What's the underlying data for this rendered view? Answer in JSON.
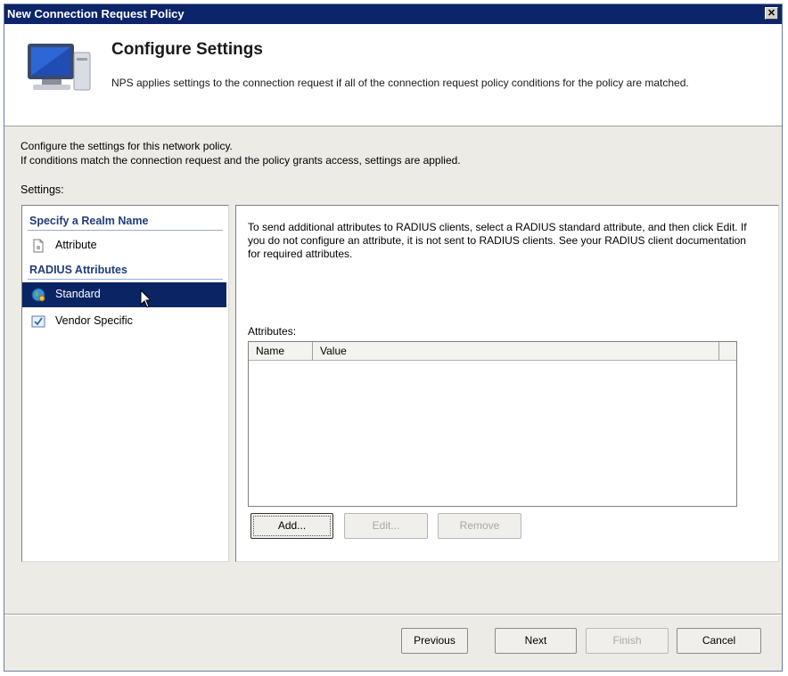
{
  "window": {
    "title": "New Connection Request Policy",
    "close_glyph": "✕"
  },
  "header": {
    "title": "Configure Settings",
    "subtitle": "NPS applies settings to the connection request if all of the connection request policy conditions for the policy are matched.",
    "icon": "computer-monitor-icon"
  },
  "description": {
    "line1": "Configure the settings for this network policy.",
    "line2": "If conditions match the connection request and the policy grants access, settings are applied."
  },
  "settings_label": "Settings:",
  "nav": {
    "groups": [
      {
        "title": "Specify a Realm Name",
        "items": [
          {
            "label": "Attribute",
            "icon": "document-icon"
          }
        ]
      },
      {
        "title": "RADIUS Attributes",
        "items": [
          {
            "label": "Standard",
            "icon": "globe-icon",
            "selected": true
          },
          {
            "label": "Vendor Specific",
            "icon": "checkbox-icon"
          }
        ]
      }
    ]
  },
  "content": {
    "instructions": "To send additional attributes to RADIUS clients, select a RADIUS standard attribute, and then click Edit. If you do not configure an attribute, it is not sent to RADIUS clients. See your RADIUS client documentation for required attributes.",
    "attributes_label": "Attributes:",
    "columns": [
      "Name",
      "Value"
    ],
    "rows": [],
    "buttons": {
      "add": "Add...",
      "edit": "Edit...",
      "remove": "Remove"
    }
  },
  "footer": {
    "previous": "Previous",
    "next": "Next",
    "finish": "Finish",
    "cancel": "Cancel"
  },
  "colors": {
    "titlebar": "#0b246a",
    "selection": "#0a2464",
    "group_heading": "#1f3d7a"
  }
}
